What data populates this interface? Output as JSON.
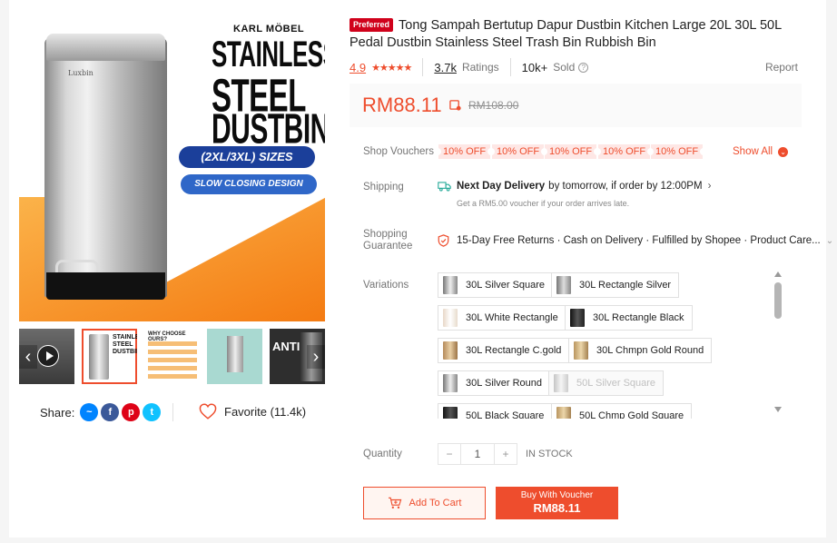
{
  "product": {
    "preferred_badge": "Preferred",
    "title": "Tong Sampah Bertutup Dapur Dustbin Kitchen Large 20L 30L 50L Pedal Dustbin Stainless Steel Trash Bin Rubbish Bin",
    "rating": "4.9",
    "ratings_count": "3.7k",
    "ratings_label": "Ratings",
    "sold_count": "10k+",
    "sold_label": "Sold",
    "report_label": "Report",
    "price": "RM88.11",
    "original_price": "RM108.00",
    "rating_stars": 5
  },
  "image": {
    "brand": "KARL MÖBEL",
    "headline1": "STAINLESS",
    "headline2": "STEEL",
    "headline3": "DUSTBIN",
    "sizes_label": "(2XL/3XL) SIZES",
    "closing_label": "SLOW CLOSING DESIGN",
    "bin_brand": "Luxbin",
    "thumb3_text": "WHY CHOOSE OURS?",
    "thumb5_text": "ANTI"
  },
  "share": {
    "label": "Share:",
    "favorite_label": "Favorite (11.4k)"
  },
  "vouchers": {
    "label": "Shop Vouchers",
    "items": [
      "10% OFF",
      "10% OFF",
      "10% OFF",
      "10% OFF",
      "10% OFF"
    ],
    "show_all": "Show All"
  },
  "shipping": {
    "label": "Shipping",
    "title": "Next Day Delivery",
    "detail": "by tomorrow, if order by 12:00PM",
    "sub": "Get a RM5.00 voucher if your order arrives late."
  },
  "guarantee": {
    "label_line1": "Shopping",
    "label_line2": "Guarantee",
    "text": "15-Day Free Returns · Cash on Delivery · Fulfilled by Shopee · Product Care..."
  },
  "variations": {
    "label": "Variations",
    "items": [
      {
        "name": "30L Silver Square",
        "disabled": false
      },
      {
        "name": "30L Rectangle Silver",
        "disabled": false
      },
      {
        "name": "30L White Rectangle",
        "disabled": false
      },
      {
        "name": "30L Rectangle Black",
        "disabled": false
      },
      {
        "name": "30L Rectangle C.gold",
        "disabled": false
      },
      {
        "name": "30L Chmpn Gold Round",
        "disabled": false
      },
      {
        "name": "30L Silver Round",
        "disabled": false
      },
      {
        "name": "50L Silver Square",
        "disabled": true
      },
      {
        "name": "50L Black Square",
        "disabled": false
      },
      {
        "name": "50L Chmp Gold Square",
        "disabled": false
      }
    ]
  },
  "quantity": {
    "label": "Quantity",
    "minus": "−",
    "value": "1",
    "plus": "+",
    "stock": "IN STOCK"
  },
  "actions": {
    "add_to_cart": "Add To Cart",
    "buy_line1": "Buy With Voucher",
    "buy_line2": "RM88.11"
  },
  "colors": {
    "accent": "#ee4d2d",
    "preferred": "#d0011b"
  }
}
